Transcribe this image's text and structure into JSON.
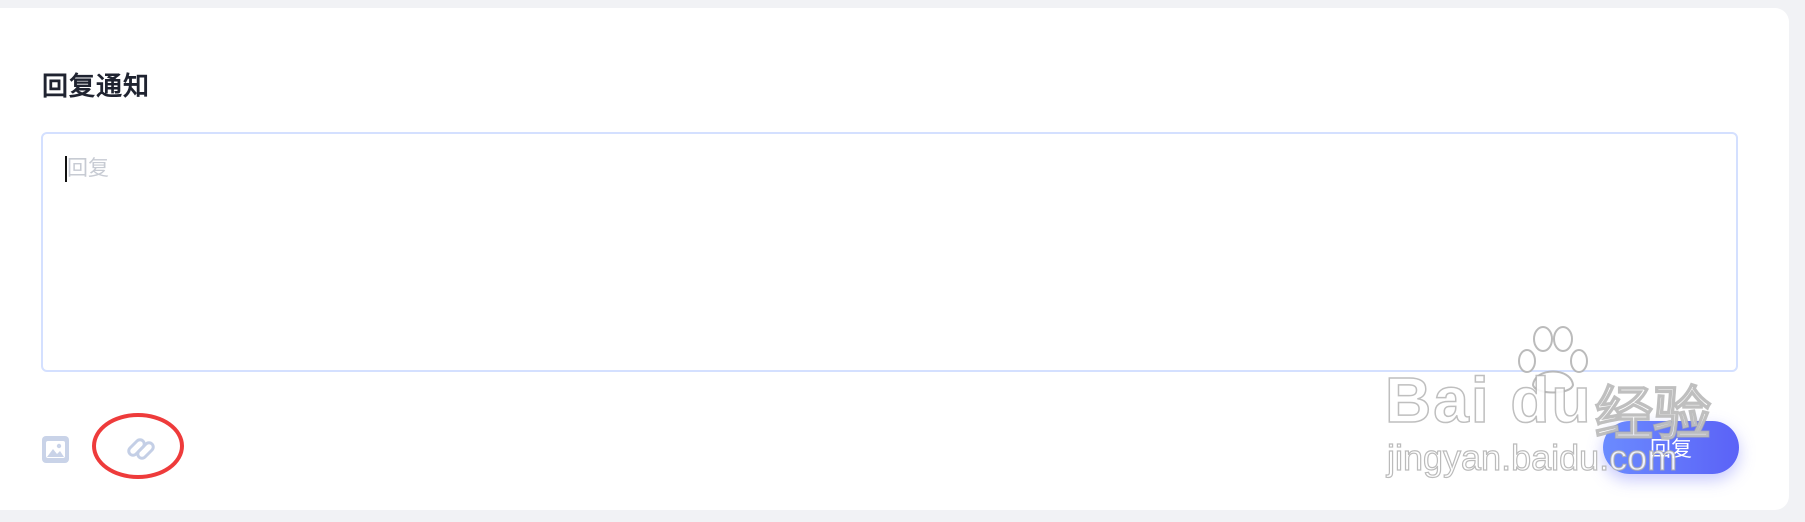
{
  "section": {
    "title": "回复通知"
  },
  "editor": {
    "placeholder": "回复",
    "value": ""
  },
  "toolbar": {
    "image_icon": "image-icon",
    "link_icon": "link-icon",
    "submit_label": "回复"
  },
  "watermark": {
    "brand": "Bai du",
    "chinese": "经验",
    "site": "jingyan.baidu.com"
  },
  "colors": {
    "accent_start": "#6b8bff",
    "accent_end": "#5b62f7",
    "editor_border": "#d4e0ff",
    "annotation": "#ee3b3b",
    "icon": "#c9d3e8"
  }
}
